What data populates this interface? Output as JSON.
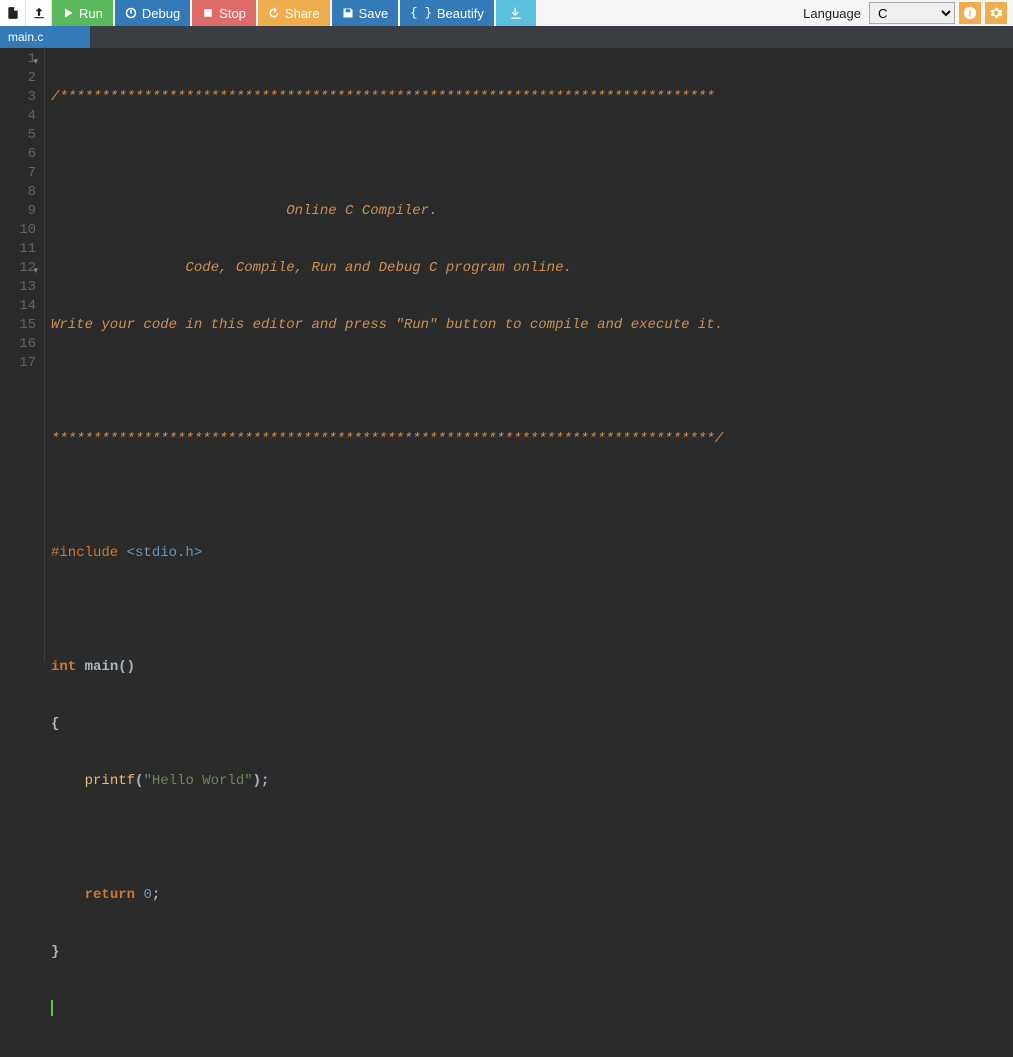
{
  "toolbar": {
    "run": "Run",
    "debug": "Debug",
    "stop": "Stop",
    "share": "Share",
    "save": "Save",
    "beautify": "Beautify",
    "language_label": "Language",
    "language_value": "C"
  },
  "tab": {
    "name": "main.c"
  },
  "gutter": {
    "lines": [
      "1",
      "2",
      "3",
      "4",
      "5",
      "6",
      "7",
      "8",
      "9",
      "10",
      "11",
      "12",
      "13",
      "14",
      "15",
      "16",
      "17"
    ]
  },
  "code": {
    "l1": "/******************************************************************************",
    "l2": "",
    "l3_pad": "                            ",
    "l3": "Online C Compiler.",
    "l4_pad": "                ",
    "l4": "Code, Compile, Run and Debug C program online.",
    "l5": "Write your code in this editor and press \"Run\" button to compile and execute it.",
    "l6": "",
    "l7": "*******************************************************************************/",
    "l8": "",
    "l9_inc": "#include ",
    "l9_hdr": "<stdio.h>",
    "l10": "",
    "l11_int": "int",
    "l11_main": " main",
    "l11_paren": "()",
    "l12": "{",
    "l13_pad": "    ",
    "l13_printf": "printf",
    "l13_open": "(",
    "l13_str": "\"Hello World\"",
    "l13_close": ");",
    "l14": "",
    "l15_pad": "    ",
    "l15_ret": "return",
    "l15_sp": " ",
    "l15_zero": "0",
    "l15_semi": ";",
    "l16": "}",
    "l17": ""
  }
}
